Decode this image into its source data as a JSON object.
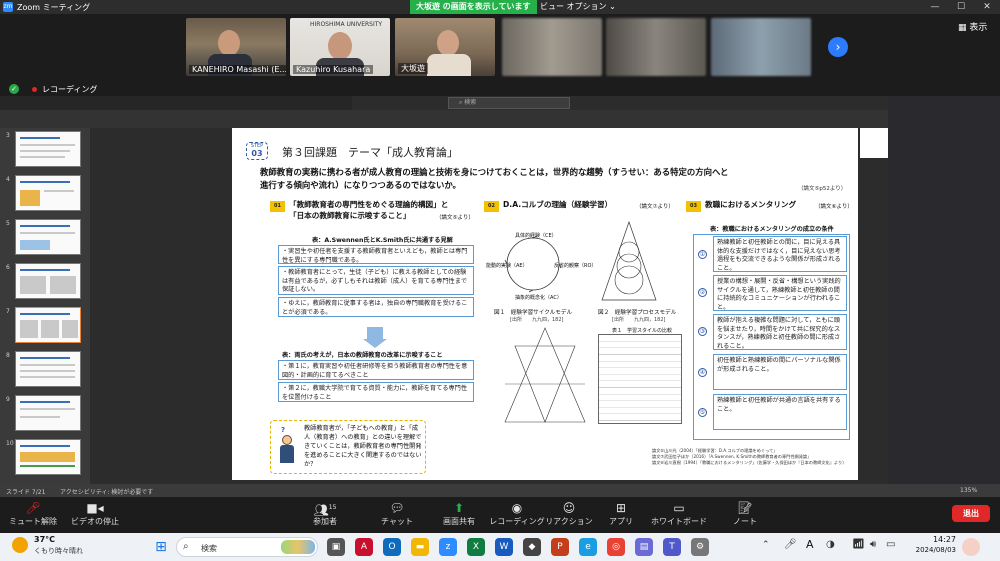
{
  "app": {
    "title": "Zoom ミーティング",
    "logo_text": "zm"
  },
  "share_banner": "大坂遊 の画面を表示しています",
  "view_options": "ビュー オプション",
  "window_controls": {
    "minimize": "—",
    "maximize": "☐",
    "close": "✕"
  },
  "participants": [
    {
      "name": "KANEHIRO Masashi (E..."
    },
    {
      "name": "Kazuhiro Kusahara",
      "sign": "HIROSHIMA UNIVERSITY"
    },
    {
      "name": "大坂遊"
    },
    {
      "name": ""
    },
    {
      "name": ""
    },
    {
      "name": ""
    },
    {
      "name": ""
    }
  ],
  "show_button": "表示",
  "recording_label": "レコーディング",
  "ppt": {
    "search_placeholder": "検索",
    "thumb_numbers": [
      "3",
      "4",
      "5",
      "6",
      "7",
      "8",
      "9",
      "10"
    ],
    "status_left": "スライド 7/21",
    "status_access": "アクセシビリティ: 検討が必要です",
    "zoom_pct": "135%"
  },
  "slide": {
    "step_label": "STEP",
    "step_num": "03",
    "header": "第３回課題　テーマ「成人教育論」",
    "main_text_1": "教師教育の実務に携わる者が成人教育の理論と技術を身につけておくことは，世界的な趨勢（すうせい：ある特定の方向へと",
    "main_text_2": "進行する傾向や流れ）になりつつあるのではないか。",
    "cite_main": "（論文⑤p52より）",
    "point_label": "POINT",
    "p1_num": "01",
    "p1_title_1": "「教師教育者の専門性をめぐる理論的構図」と",
    "p1_title_2": "「日本の教師教育に示唆すること」",
    "p1_cite": "（論文⑤より）",
    "p2_num": "02",
    "p2_title": "D.A.コルブの理論（経験学習）",
    "p2_cite": "（論文⑦より）",
    "p3_num": "03",
    "p3_title": "教職におけるメンタリング",
    "p3_cite": "（論文⑥より）",
    "table1_title": "表：A.Swennen氏とK.Smith氏に共通する見解",
    "t1_items": [
      "・実習生や初任者を支援する教師教育者といえども，教師とは専門性を異にする専門職である。",
      "・教師教育者にとって，生徒（子ども）に教える教師としての経験は有益であるが，必ずしもそれは教師（成人）を育てる専門性まで保証しない。",
      "・ゆえに，教師教育に従事する者は，独自の専門職教育を受けることが必須である。"
    ],
    "table2_title": "表：両氏の考えが，日本の教師教育の改革に示唆すること",
    "t2_items": [
      "・第１に，教育実習や初任者研修等を担う教師教育者の専門性を意図的・計画的に育てるべきこと",
      "・第２に，教職大学院で育てる資質・能力に，教師を育てる専門性を位置付けること"
    ],
    "thought_text": "教師教育者が，「子どもへの教育」と「成人（教育者）への教育」との違いを理解できていくことは，教師教育者の専門性開発を進めることに大きく関連するのではないか？",
    "kolb_top": "具体的経験（CE）",
    "kolb_right": "反省的観察（RO）",
    "kolb_bottom": "抽象的概念化（AC）",
    "kolb_left": "能動的実験（AE）",
    "fig1_caption": "図１　経験学習サイクルモデル",
    "fig1_source": "[出所　　九九四，182]",
    "fig2_caption": "図２　経験学習プロセスモデル",
    "fig2_source": "[出所　　九九四，182]",
    "table_small_title": "表１　学習スタイルの比較",
    "mentor_title": "表：教職におけるメンタリングの成立の条件",
    "mentor_items": [
      {
        "num": "①",
        "text": "熟練教師と初任教師との間に，目に見える具体的な支援だけではなく，目に見えない思考過程をも交流できるような関係が形成されること。"
      },
      {
        "num": "②",
        "text": "授業の構想・展開・反省・構想という実践的サイクルを通して，熟練教師と初任教師の間に持続的なコミュニケーションが行われること。"
      },
      {
        "num": "③",
        "text": "教師が抱える複雑な問題に対して，ともに頭を悩ませたり，時間をかけて共に探究的なスタンスが，熟練教師と初任教師の間に形成されること。"
      },
      {
        "num": "④",
        "text": "初任教師と熟練教師の間にパーソナルな関係が形成されること。"
      },
      {
        "num": "⑤",
        "text": "熟練教師と初任教師が共通の言語を共有すること。"
      }
    ],
    "refs": [
      "論文⑤山川光（2004）「経験学習：D.A.コルブの理論をめぐって」",
      "論文⑦武田信子ほか（2016）「A.Swennen, K.Smithの教師教育者の専門性開発論」",
      "論文⑥岩川直樹（1994）「教職におけるメンタリング」（佐藤学・久保田ほか『日本の教師文化』より）"
    ]
  },
  "toolbar": [
    {
      "label": "ミュート解除",
      "icon": "mic-off-icon"
    },
    {
      "label": "ビデオの停止",
      "icon": "video-icon"
    },
    {
      "label": "参加者",
      "icon": "participants-icon",
      "count": "15"
    },
    {
      "label": "チャット",
      "icon": "chat-icon"
    },
    {
      "label": "画面共有",
      "icon": "share-screen-icon"
    },
    {
      "label": "レコーディング",
      "icon": "record-icon"
    },
    {
      "label": "リアクション",
      "icon": "reaction-icon"
    },
    {
      "label": "アプリ",
      "icon": "apps-icon"
    },
    {
      "label": "ホワイトボード",
      "icon": "whiteboard-icon"
    },
    {
      "label": "ノート",
      "icon": "notes-icon"
    }
  ],
  "end_button": "退出",
  "taskbar": {
    "weather_temp": "37°C",
    "weather_desc": "くもり時々晴れ",
    "search_label": "検索",
    "time": "14:27",
    "date": "2024/08/03",
    "ime": "A"
  },
  "colors": {
    "share_green": "#25b04a",
    "end_red": "#e02828",
    "zoom_blue": "#2d8cff",
    "point_yellow": "#f2c100",
    "box_blue": "#5b9bd5"
  }
}
